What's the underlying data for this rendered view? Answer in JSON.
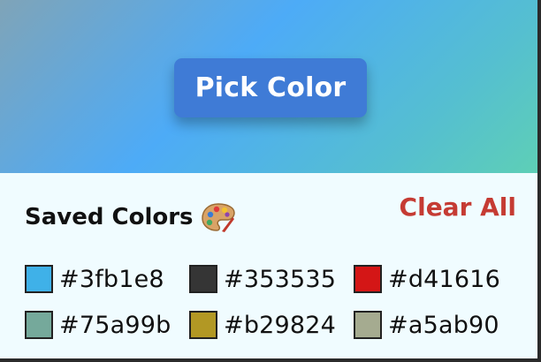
{
  "hero": {
    "pick_button_label": "Pick Color"
  },
  "saved": {
    "title": "Saved Colors",
    "title_icon": "palette-icon",
    "clear_all_label": "Clear All",
    "colors": [
      {
        "code": "#3fb1e8",
        "hex": "#3fb1e8"
      },
      {
        "code": "#353535",
        "hex": "#353535"
      },
      {
        "code": "#d41616",
        "hex": "#d41616"
      },
      {
        "code": "#75a99b",
        "hex": "#75a99b"
      },
      {
        "code": "#b29824",
        "hex": "#b29824"
      },
      {
        "code": "#a5ab90",
        "hex": "#a5ab90"
      }
    ]
  },
  "theme": {
    "button_color": "#3f7bd6",
    "clear_all_color": "#c53b33",
    "panel_background": "#f0fcff"
  }
}
